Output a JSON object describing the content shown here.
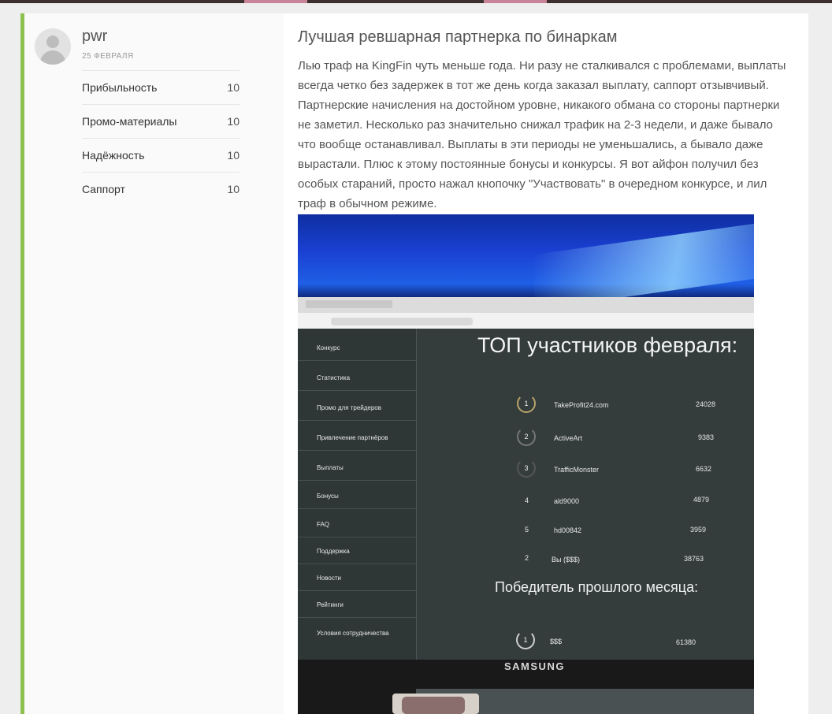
{
  "review": {
    "author": "pwr",
    "date": "25 ФЕВРАЛЯ",
    "ratings": [
      {
        "label": "Прибыльность",
        "value": "10"
      },
      {
        "label": "Промо-материалы",
        "value": "10"
      },
      {
        "label": "Надёжность",
        "value": "10"
      },
      {
        "label": "Саппорт",
        "value": "10"
      }
    ],
    "title": "Лучшая ревшарная партнерка по бинаркам",
    "text": "Лью траф на KingFin чуть меньше года. Ни разу не сталкивался с проблемами, выплаты всегда четко без задержек в тот же день когда заказал выплату, саппорт отзывчивый. Партнерские начисления на достойном уровне, никакого обмана со стороны партнерки не заметил. Несколько раз значительно снижал трафик на 2-3 недели, и даже бывало что вообще останавливал. Выплаты в эти периоды не уменьшались, а бывало даже вырастали. Плюс к этому постоянные бонусы и конкурсы. Я вот айфон получил без особых стараний, просто нажал кнопочку \"Участвовать\" в очередном конкурсе, и лил траф в обычном режиме."
  },
  "photo": {
    "screen_menu": [
      "Конкурс",
      "Статистика",
      "Промо для трейдеров",
      "Привлечение партнёров",
      "Выплаты",
      "Бонусы",
      "FAQ",
      "Поддержка",
      "Новости",
      "Рейтинги",
      "Условия сотрудничества"
    ],
    "screen_title": "ТОП участников февраля:",
    "top": [
      {
        "rank": "1",
        "name": "TakeProfit24.com",
        "score": "24028"
      },
      {
        "rank": "2",
        "name": "ActiveArt",
        "score": "9383"
      },
      {
        "rank": "3",
        "name": "TrafficMonster",
        "score": "6632"
      },
      {
        "rank": "4",
        "name": "ald9000",
        "score": "4879"
      },
      {
        "rank": "5",
        "name": "hd00842",
        "score": "3959"
      },
      {
        "rank": "2",
        "name": "Вы ($$$)",
        "score": "38763"
      }
    ],
    "winner_title": "Победитель прошлого месяца:",
    "winner": {
      "rank": "1",
      "name": "$$$",
      "score": "61380"
    },
    "brand": "SAMSUNG"
  },
  "colors": {
    "accent_border": "#8cc152",
    "topbar": "#3b302f",
    "topbar_accent": "#c9849a"
  }
}
